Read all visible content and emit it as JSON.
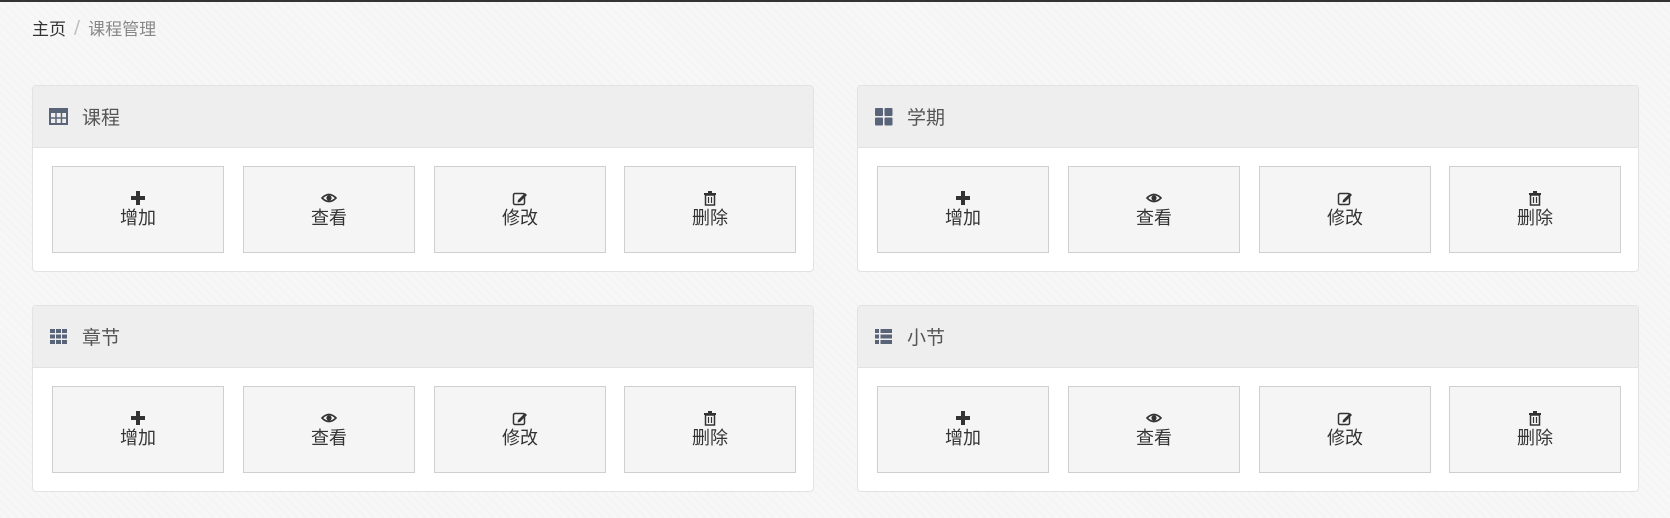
{
  "breadcrumb": {
    "home": "主页",
    "separator": "/",
    "current": "课程管理"
  },
  "panels": [
    {
      "title": "课程",
      "icon": "table-icon",
      "buttons": [
        {
          "label": "增加",
          "icon": "plus-icon"
        },
        {
          "label": "查看",
          "icon": "eye-icon"
        },
        {
          "label": "修改",
          "icon": "edit-icon"
        },
        {
          "label": "删除",
          "icon": "trash-icon"
        }
      ]
    },
    {
      "title": "学期",
      "icon": "th-large-icon",
      "buttons": [
        {
          "label": "增加",
          "icon": "plus-icon"
        },
        {
          "label": "查看",
          "icon": "eye-icon"
        },
        {
          "label": "修改",
          "icon": "edit-icon"
        },
        {
          "label": "删除",
          "icon": "trash-icon"
        }
      ]
    },
    {
      "title": "章节",
      "icon": "th-icon",
      "buttons": [
        {
          "label": "增加",
          "icon": "plus-icon"
        },
        {
          "label": "查看",
          "icon": "eye-icon"
        },
        {
          "label": "修改",
          "icon": "edit-icon"
        },
        {
          "label": "删除",
          "icon": "trash-icon"
        }
      ]
    },
    {
      "title": "小节",
      "icon": "th-list-icon",
      "buttons": [
        {
          "label": "增加",
          "icon": "plus-icon"
        },
        {
          "label": "查看",
          "icon": "eye-icon"
        },
        {
          "label": "修改",
          "icon": "edit-icon"
        },
        {
          "label": "删除",
          "icon": "trash-icon"
        }
      ]
    }
  ],
  "colors": {
    "page_background": "#f7f7f7",
    "panel_heading": "#eeeeee",
    "button_background": "#f5f5f5",
    "icon_color": "#5a6479"
  }
}
